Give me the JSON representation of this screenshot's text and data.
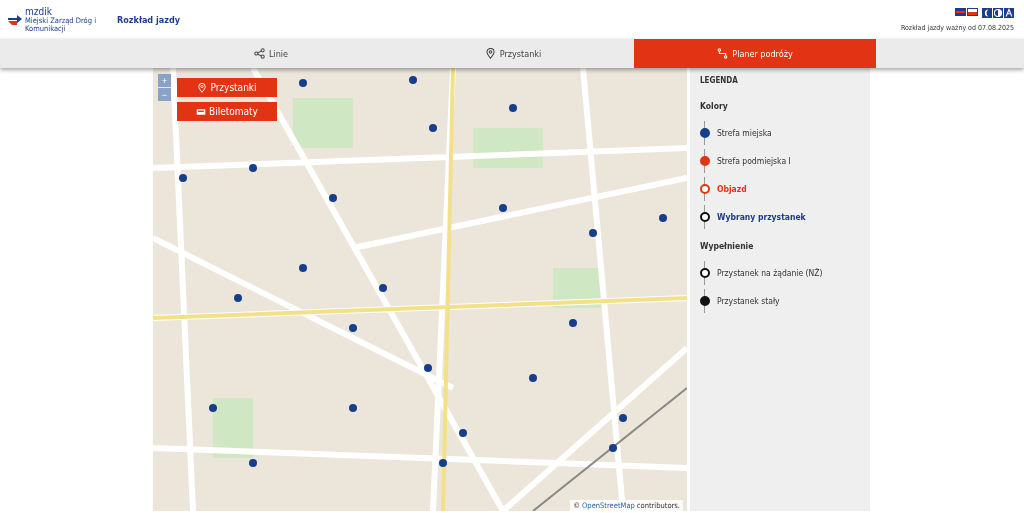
{
  "header": {
    "logo": {
      "name": "mzdik",
      "subtitle": "Miejski Zarząd Dróg i Komunikacji"
    },
    "title": "Rozkład jazdy",
    "validity": "Rozkład jazdy ważny od 07.08.2025"
  },
  "tabs": [
    {
      "label": "Linie",
      "selected": false
    },
    {
      "label": "Przystanki",
      "selected": false
    },
    {
      "label": "Planer podróży",
      "selected": true
    }
  ],
  "map": {
    "zoom": [
      "+",
      "−"
    ],
    "buttons": [
      "Przystanki",
      "Biletomaty"
    ],
    "attribution": {
      "prefix": "©",
      "link": "OpenStreetMap",
      "suffix": "contributors."
    }
  },
  "legend": {
    "title": "LEGENDA",
    "sections": [
      {
        "heading": "Kolory",
        "items": [
          {
            "label": "Strefa miejska",
            "kind": "zone",
            "color": "#173e8c"
          },
          {
            "label": "Strefa podmiejska I",
            "kind": "zone",
            "color": "#e23414"
          },
          {
            "label": "Objazd",
            "kind": "detour",
            "color": "#e23414"
          },
          {
            "label": "Wybrany przystanek",
            "kind": "chosen",
            "color": "#111111"
          }
        ]
      },
      {
        "heading": "Wypełnienie",
        "items": [
          {
            "label": "Przystanek na żądanie (NŻ)",
            "kind": "request",
            "color": "#111111"
          },
          {
            "label": "Przystanek stały",
            "kind": "fixed",
            "color": "#111111"
          }
        ]
      }
    ]
  }
}
